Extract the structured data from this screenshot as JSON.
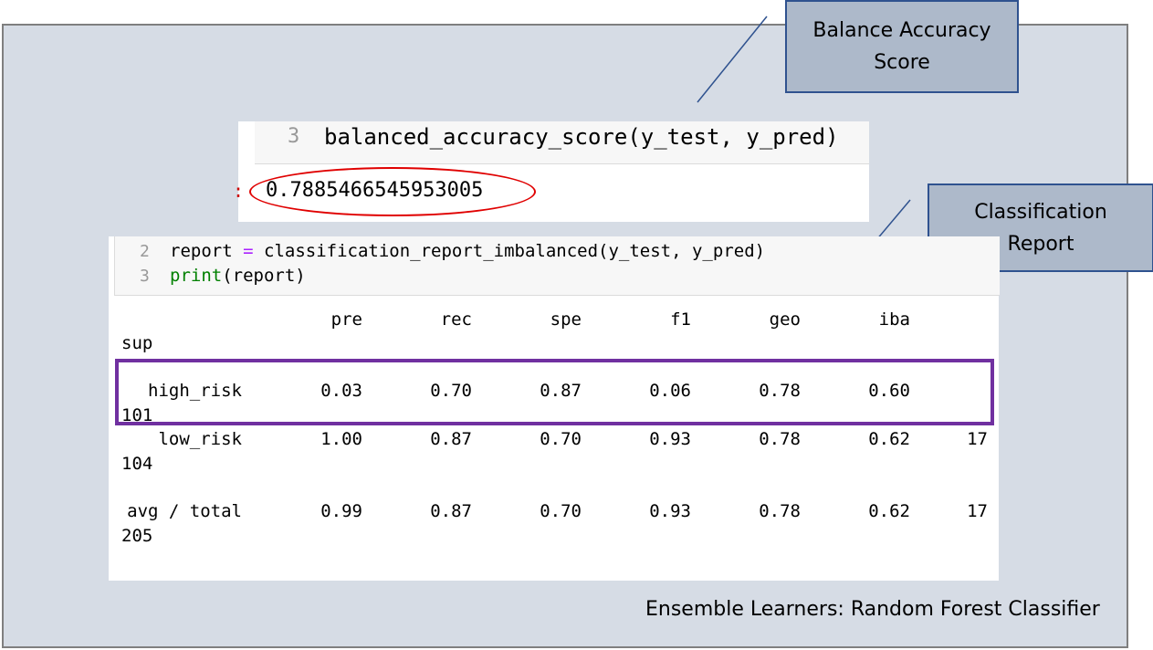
{
  "callouts": {
    "balance_accuracy": [
      "Balance Accuracy",
      "Score"
    ],
    "classification_report": [
      "Classification",
      "Report"
    ]
  },
  "accuracy_cell": {
    "line_number": "3",
    "code": "balanced_accuracy_score(y_test, y_pred)",
    "output_prompt": ":",
    "score": "0.7885466545953005"
  },
  "report_cell": {
    "lines": [
      {
        "number": "2",
        "var": "report",
        "op": "=",
        "rest": "classification_report_imbalanced(y_test, y_pred)"
      },
      {
        "number": "3",
        "fn": "print",
        "rest": "(report)"
      }
    ]
  },
  "report": {
    "headers": [
      "pre",
      "rec",
      "spe",
      "f1",
      "geo",
      "iba"
    ],
    "sup_header": "sup",
    "rows": [
      {
        "label": "high_risk",
        "values": [
          "0.03",
          "0.70",
          "0.87",
          "0.06",
          "0.78",
          "0.60"
        ],
        "trail": "",
        "wrap": "101"
      },
      {
        "label": "low_risk",
        "values": [
          "1.00",
          "0.87",
          "0.70",
          "0.93",
          "0.78",
          "0.62"
        ],
        "trail": "17",
        "wrap": "104"
      },
      {
        "label": "avg / total",
        "values": [
          "0.99",
          "0.87",
          "0.70",
          "0.93",
          "0.78",
          "0.62"
        ],
        "trail": "17",
        "wrap": "205"
      }
    ]
  },
  "footer": "Ensemble Learners: Random Forest Classifier",
  "colors": {
    "frame_bg": "#d6dce5",
    "callout_bg": "#adb9ca",
    "callout_border": "#2f528f",
    "highlight_ellipse": "#e00000",
    "highlight_box": "#7030a0"
  }
}
